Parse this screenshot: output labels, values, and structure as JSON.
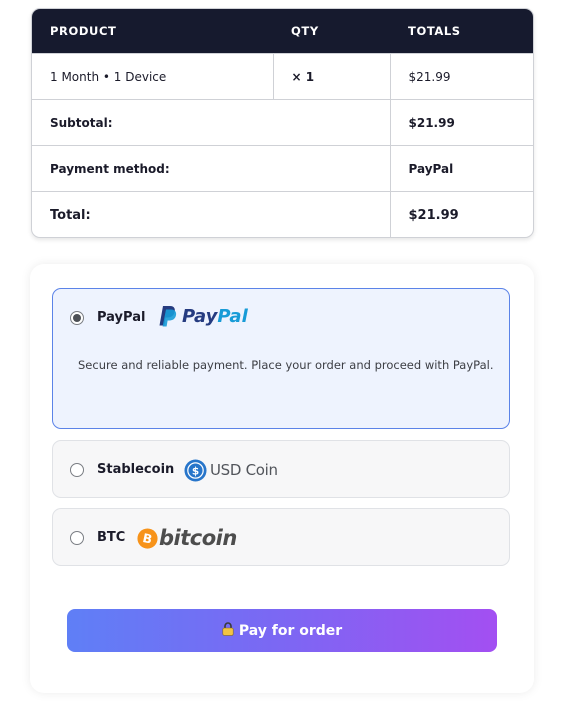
{
  "order_table": {
    "headers": {
      "product": "PRODUCT",
      "qty": "QTY",
      "totals": "TOTALS"
    },
    "item": {
      "product": "1 Month • 1 Device",
      "qty": "× 1",
      "total": "$21.99"
    },
    "subtotal": {
      "label": "Subtotal:",
      "value": "$21.99"
    },
    "payment_method": {
      "label": "Payment method:",
      "value": "PayPal"
    },
    "total": {
      "label": "Total:",
      "value": "$21.99"
    }
  },
  "payment": {
    "methods": [
      {
        "label": "PayPal",
        "logo_text": [
          "Pay",
          "Pal"
        ],
        "selected": true,
        "description": "Secure and reliable payment. Place your order and proceed with PayPal."
      },
      {
        "label": "Stablecoin",
        "logo_text": [
          "USD",
          "Coin"
        ],
        "selected": false
      },
      {
        "label": "BTC",
        "logo_text": "bitcoin",
        "selected": false
      }
    ],
    "pay_button_label": "Pay for order"
  },
  "colors": {
    "table_header_bg": "#161a2e",
    "selected_bg": "#eef3fe",
    "selected_border": "#5b83e8",
    "button_gradient": [
      "#5f7ff6",
      "#a34ff2"
    ],
    "paypal_dark": "#253b80",
    "paypal_light": "#179bd7",
    "usdc_blue": "#2775ca",
    "bitcoin_orange": "#f7931a"
  }
}
